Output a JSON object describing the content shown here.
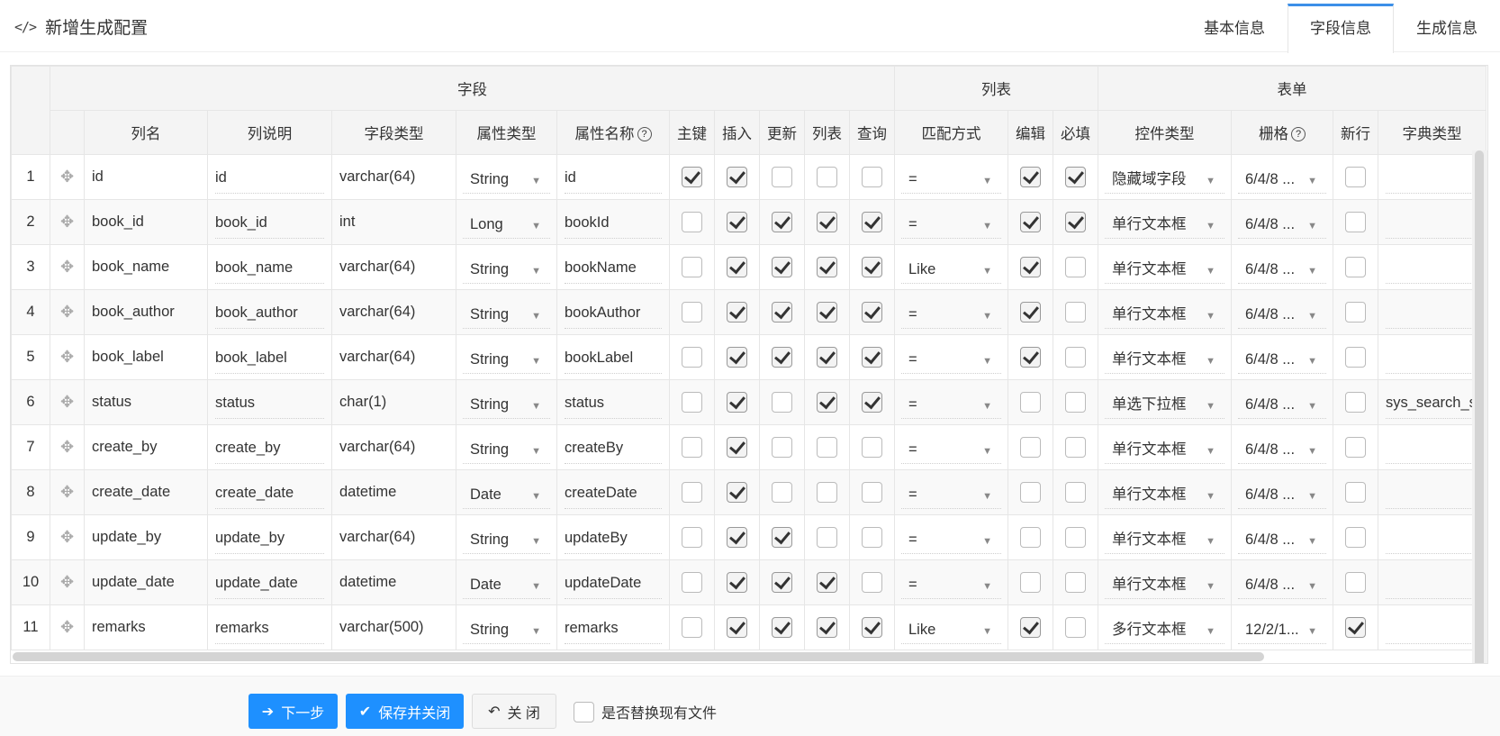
{
  "header": {
    "title": "新增生成配置",
    "icon": "code-icon",
    "tabs": [
      {
        "label": "基本信息",
        "active": false
      },
      {
        "label": "字段信息",
        "active": true
      },
      {
        "label": "生成信息",
        "active": false
      }
    ]
  },
  "table": {
    "groups": {
      "field": "字段",
      "list": "列表",
      "form": "表单"
    },
    "columns": {
      "col_name": "列名",
      "col_desc": "列说明",
      "field_type": "字段类型",
      "attr_type": "属性类型",
      "attr_name": "属性名称",
      "pk": "主键",
      "insert": "插入",
      "update": "更新",
      "list": "列表",
      "query": "查询",
      "match": "匹配方式",
      "edit": "编辑",
      "required": "必填",
      "control": "控件类型",
      "grid": "栅格",
      "newline": "新行",
      "dict": "字典类型"
    },
    "help_icon": "?",
    "rows": [
      {
        "num": "1",
        "name": "id",
        "desc": "id",
        "ftype": "varchar(64)",
        "atype": "String",
        "aname": "id",
        "pk": true,
        "ins": true,
        "upd": false,
        "lst": false,
        "qry": false,
        "match": "=",
        "edit": true,
        "req": true,
        "ctrl": "隐藏域字段",
        "grid": "6/4/8 ...",
        "nl": false,
        "dict": ""
      },
      {
        "num": "2",
        "name": "book_id",
        "desc": "book_id",
        "ftype": "int",
        "atype": "Long",
        "aname": "bookId",
        "pk": false,
        "ins": true,
        "upd": true,
        "lst": true,
        "qry": true,
        "match": "=",
        "edit": true,
        "req": true,
        "ctrl": "单行文本框",
        "grid": "6/4/8 ...",
        "nl": false,
        "dict": ""
      },
      {
        "num": "3",
        "name": "book_name",
        "desc": "book_name",
        "ftype": "varchar(64)",
        "atype": "String",
        "aname": "bookName",
        "pk": false,
        "ins": true,
        "upd": true,
        "lst": true,
        "qry": true,
        "match": "Like",
        "edit": true,
        "req": false,
        "ctrl": "单行文本框",
        "grid": "6/4/8 ...",
        "nl": false,
        "dict": ""
      },
      {
        "num": "4",
        "name": "book_author",
        "desc": "book_author",
        "ftype": "varchar(64)",
        "atype": "String",
        "aname": "bookAuthor",
        "pk": false,
        "ins": true,
        "upd": true,
        "lst": true,
        "qry": true,
        "match": "=",
        "edit": true,
        "req": false,
        "ctrl": "单行文本框",
        "grid": "6/4/8 ...",
        "nl": false,
        "dict": ""
      },
      {
        "num": "5",
        "name": "book_label",
        "desc": "book_label",
        "ftype": "varchar(64)",
        "atype": "String",
        "aname": "bookLabel",
        "pk": false,
        "ins": true,
        "upd": true,
        "lst": true,
        "qry": true,
        "match": "=",
        "edit": true,
        "req": false,
        "ctrl": "单行文本框",
        "grid": "6/4/8 ...",
        "nl": false,
        "dict": ""
      },
      {
        "num": "6",
        "name": "status",
        "desc": "status",
        "ftype": "char(1)",
        "atype": "String",
        "aname": "status",
        "pk": false,
        "ins": true,
        "upd": false,
        "lst": true,
        "qry": true,
        "match": "=",
        "edit": false,
        "req": false,
        "ctrl": "单选下拉框",
        "grid": "6/4/8 ...",
        "nl": false,
        "dict": "sys_search_s"
      },
      {
        "num": "7",
        "name": "create_by",
        "desc": "create_by",
        "ftype": "varchar(64)",
        "atype": "String",
        "aname": "createBy",
        "pk": false,
        "ins": true,
        "upd": false,
        "lst": false,
        "qry": false,
        "match": "=",
        "edit": false,
        "req": false,
        "ctrl": "单行文本框",
        "grid": "6/4/8 ...",
        "nl": false,
        "dict": ""
      },
      {
        "num": "8",
        "name": "create_date",
        "desc": "create_date",
        "ftype": "datetime",
        "atype": "Date",
        "aname": "createDate",
        "pk": false,
        "ins": true,
        "upd": false,
        "lst": false,
        "qry": false,
        "match": "=",
        "edit": false,
        "req": false,
        "ctrl": "单行文本框",
        "grid": "6/4/8 ...",
        "nl": false,
        "dict": ""
      },
      {
        "num": "9",
        "name": "update_by",
        "desc": "update_by",
        "ftype": "varchar(64)",
        "atype": "String",
        "aname": "updateBy",
        "pk": false,
        "ins": true,
        "upd": true,
        "lst": false,
        "qry": false,
        "match": "=",
        "edit": false,
        "req": false,
        "ctrl": "单行文本框",
        "grid": "6/4/8 ...",
        "nl": false,
        "dict": ""
      },
      {
        "num": "10",
        "name": "update_date",
        "desc": "update_date",
        "ftype": "datetime",
        "atype": "Date",
        "aname": "updateDate",
        "pk": false,
        "ins": true,
        "upd": true,
        "lst": true,
        "qry": false,
        "match": "=",
        "edit": false,
        "req": false,
        "ctrl": "单行文本框",
        "grid": "6/4/8 ...",
        "nl": false,
        "dict": ""
      },
      {
        "num": "11",
        "name": "remarks",
        "desc": "remarks",
        "ftype": "varchar(500)",
        "atype": "String",
        "aname": "remarks",
        "pk": false,
        "ins": true,
        "upd": true,
        "lst": true,
        "qry": true,
        "match": "Like",
        "edit": true,
        "req": false,
        "ctrl": "多行文本框",
        "grid": "12/2/1...",
        "nl": true,
        "dict": ""
      }
    ]
  },
  "footer": {
    "next_label": "下一步",
    "save_label": "保存并关闭",
    "close_label": "关 闭",
    "replace_label": "是否替换现有文件",
    "replace_checked": false
  },
  "colors": {
    "primary": "#1e90ff",
    "tab_active": "#3c8fe8"
  }
}
